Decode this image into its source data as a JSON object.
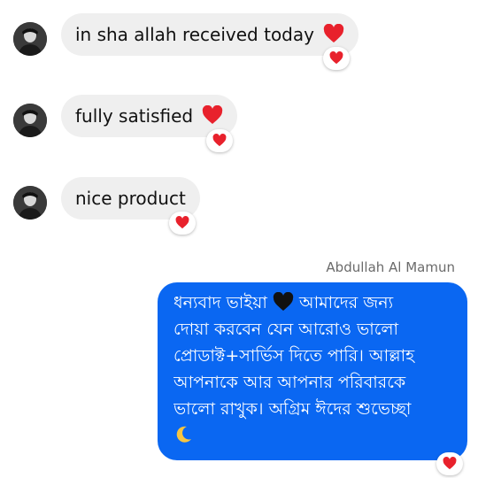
{
  "messages": [
    {
      "text": "in sha allah received today",
      "inline_emoji": "heart-icon",
      "reaction": "heart-icon"
    },
    {
      "text": "fully satisfied",
      "inline_emoji": "heart-icon",
      "reaction": "heart-icon"
    },
    {
      "text": "nice product",
      "reaction": "heart-icon"
    }
  ],
  "reply": {
    "sender": "Abdullah Al Mamun",
    "lines": [
      "ধন্যবাদ ভাইয়া",
      "আমাদের জন্য",
      "দোয়া করবেন যেন আরোও ভালো",
      "প্রোডাক্ট+সার্ভিস দিতে পারি। আল্লাহ",
      "আপনাকে আর আপনার পরিবারকে",
      "ভালো রাখুক। অগ্রিম ঈদের শুভেচ্ছা"
    ],
    "inline_emojis": [
      "black-heart-icon",
      "crescent-moon-icon"
    ],
    "reaction": "heart-icon"
  },
  "colors": {
    "incoming_bubble": "#efefef",
    "outgoing_bubble": "#0a67f2",
    "heart": "#e8212c",
    "sender_name": "#6b6b6b"
  }
}
